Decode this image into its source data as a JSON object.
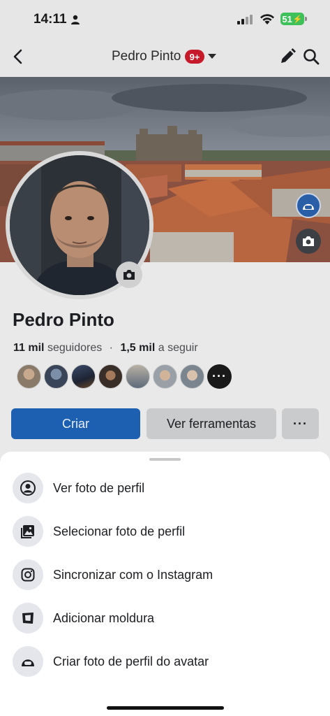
{
  "status_bar": {
    "time": "14:11",
    "battery": "51",
    "icons": [
      "person-icon",
      "signal-icon",
      "wifi-icon",
      "battery-charging-icon"
    ]
  },
  "nav": {
    "title": "Pedro Pinto",
    "badge": "9+",
    "icons": [
      "back-arrow-icon",
      "chevron-down-icon",
      "pencil-icon",
      "search-icon"
    ]
  },
  "profile": {
    "name": "Pedro Pinto",
    "followers_count": "11 mil",
    "followers_label": "seguidores",
    "separator": "·",
    "following_count": "1,5 mil",
    "following_label": "a seguir",
    "more_friends": "···"
  },
  "actions": {
    "create": "Criar",
    "tools": "Ver ferramentas",
    "more": "···"
  },
  "sheet": {
    "items": [
      {
        "label": "Ver foto de perfil",
        "icon": "profile-circle-icon"
      },
      {
        "label": "Selecionar foto de perfil",
        "icon": "photo-gallery-icon"
      },
      {
        "label": "Sincronizar com o Instagram",
        "icon": "instagram-icon"
      },
      {
        "label": "Adicionar moldura",
        "icon": "frame-icon"
      },
      {
        "label": "Criar foto de perfil do avatar",
        "icon": "avatar-icon"
      }
    ]
  },
  "colors": {
    "primary_button": "#1d5fb0",
    "badge": "#c61a2b",
    "battery": "#3ec05a",
    "overlay": "#e6e6e7"
  }
}
